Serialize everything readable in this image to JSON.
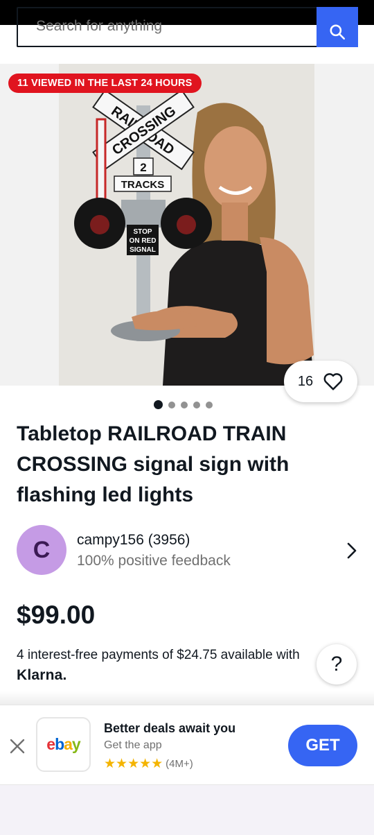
{
  "search": {
    "placeholder": "Search for anything"
  },
  "listing": {
    "views_badge": "11 VIEWED IN THE LAST 24 HOURS",
    "watch_count": "16",
    "image_count": 5,
    "title": "Tabletop RAILROAD TRAIN CROSSING signal sign with flashing led lights",
    "price": "$99.00"
  },
  "photo": {
    "sign_top": "RAILROAD",
    "sign_bottom": "CROSSING",
    "tracks_number": "2",
    "tracks_label": "TRACKS",
    "stop_lines": [
      "STOP",
      "ON RED",
      "SIGNAL"
    ]
  },
  "seller": {
    "initial": "C",
    "name": "campy156 (3956)",
    "feedback": "100% positive feedback"
  },
  "installments": {
    "text": "4 interest-free payments of $24.75 available with",
    "provider": "Klarna."
  },
  "help": {
    "label": "?"
  },
  "app_banner": {
    "title": "Better deals await you",
    "subtitle": "Get the app",
    "rating_count": "(4M+)",
    "stars": "★★★★★",
    "cta": "GET",
    "logo": {
      "e": "e",
      "b": "b",
      "a": "a",
      "y": "y"
    }
  },
  "colors": {
    "accent": "#3665f3",
    "badge": "#e0141f",
    "avatar": "#c59be5"
  }
}
